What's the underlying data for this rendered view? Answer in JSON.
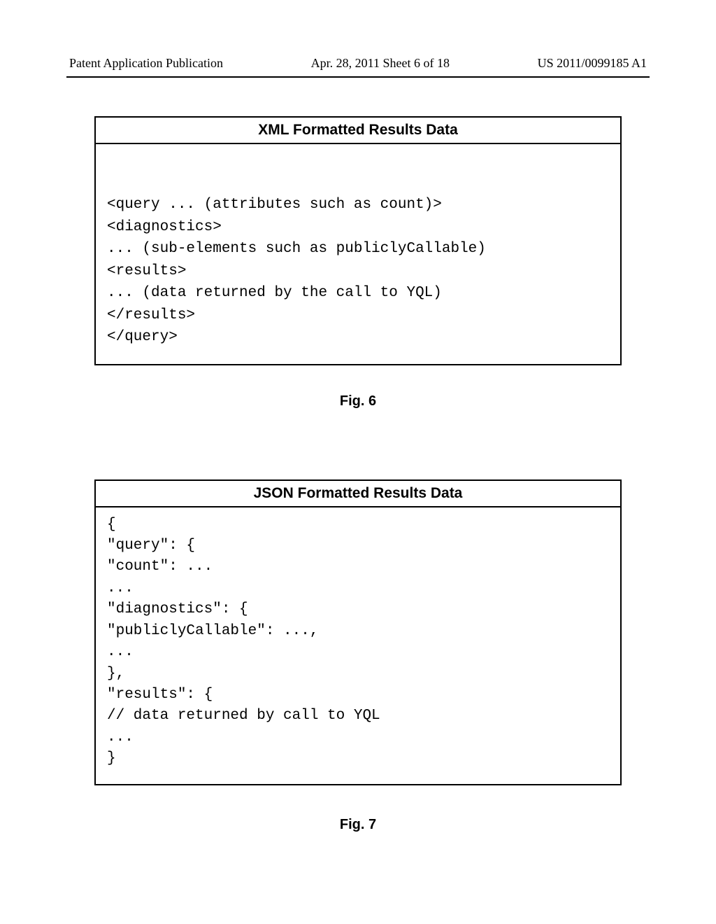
{
  "header": {
    "left": "Patent Application Publication",
    "center": "Apr. 28, 2011  Sheet 6 of 18",
    "right": "US 2011/0099185 A1"
  },
  "fig6": {
    "title": "XML Formatted Results Data",
    "body": "\n\n<query ... (attributes such as count)>\n<diagnostics>\n... (sub-elements such as publiclyCallable)\n<results>\n... (data returned by the call to YQL)\n</results>\n</query>\n",
    "caption": "Fig. 6"
  },
  "fig7": {
    "title": "JSON Formatted Results Data",
    "body": "{\n\"query\": {\n\"count\": ...\n...\n\"diagnostics\": {\n\"publiclyCallable\": ...,\n...\n},\n\"results\": {\n// data returned by call to YQL\n...\n}",
    "caption": "Fig. 7"
  }
}
